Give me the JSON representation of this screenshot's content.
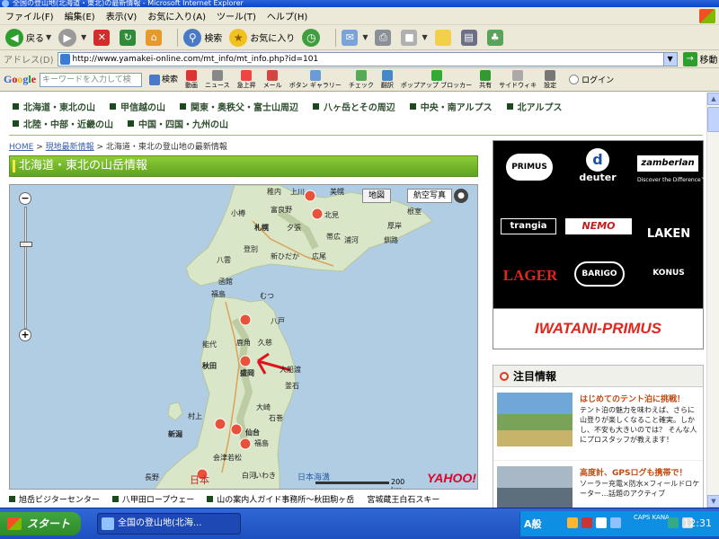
{
  "window": {
    "title": "全国の登山地(北海道・東北)の最新情報 - Microsoft Internet Explorer"
  },
  "menu": [
    "ファイル(F)",
    "編集(E)",
    "表示(V)",
    "お気に入り(A)",
    "ツール(T)",
    "ヘルプ(H)"
  ],
  "toolbar": {
    "back_label": "戻る",
    "search_label": "検索",
    "favorites_label": "お気に入り"
  },
  "address": {
    "label": "アドレス(D)",
    "url": "http://www.yamakei-online.com/mt_info/mt_info.php?id=101",
    "go_label": "移動"
  },
  "google_toolbar": {
    "logo_parts": [
      "G",
      "o",
      "o",
      "g",
      "l",
      "e"
    ],
    "search_placeholder": "キーワードを入力して検",
    "search_button": "検索",
    "items": [
      "動画",
      "ニュース",
      "急上昇",
      "メール",
      "ボタン ギャラリー",
      "チェック",
      "翻訳",
      "ポップアップ ブロッカー",
      "共有",
      "サイドウィキ",
      "設定"
    ],
    "login": "ログイン"
  },
  "region_nav": {
    "row1": [
      "北海道・東北の山",
      "甲信越の山",
      "関東・奥秩父・富士山周辺",
      "八ヶ岳とその周辺",
      "中央・南アルプス",
      "北アルプス"
    ],
    "row2": [
      "北陸・中部・近畿の山",
      "中国・四国・九州の山"
    ]
  },
  "breadcrumb": {
    "home": "HOME",
    "sep": ">",
    "section": "現地最新情報",
    "current": "北海道・東北の登山地の最新情報"
  },
  "page_title": "北海道・東北の山岳情報",
  "map": {
    "type_map": "地図",
    "type_aerial": "航空写真",
    "home_icon": "●",
    "zoom_in": "−",
    "zoom_out": "+",
    "scale_label": "200 km",
    "sea_label": "日本海溝",
    "country_label": "日本",
    "logo": "YAHOO!",
    "places": [
      {
        "name": "稚内",
        "bold": false
      },
      {
        "name": "上川",
        "bold": false
      },
      {
        "name": "美幌",
        "bold": false
      },
      {
        "name": "小樽",
        "bold": false
      },
      {
        "name": "富良野",
        "bold": false
      },
      {
        "name": "北見",
        "bold": false
      },
      {
        "name": "根室",
        "bold": false
      },
      {
        "name": "札幌",
        "bold": true
      },
      {
        "name": "夕張",
        "bold": false
      },
      {
        "name": "帯広",
        "bold": false
      },
      {
        "name": "厚岸",
        "bold": false
      },
      {
        "name": "釧路",
        "bold": false
      },
      {
        "name": "浦河",
        "bold": false
      },
      {
        "name": "登別",
        "bold": false
      },
      {
        "name": "新ひだか",
        "bold": false
      },
      {
        "name": "八雲",
        "bold": false
      },
      {
        "name": "広尾",
        "bold": false
      },
      {
        "name": "函館",
        "bold": false
      },
      {
        "name": "福島",
        "bold": false
      },
      {
        "name": "むつ",
        "bold": false
      },
      {
        "name": "八戸",
        "bold": false
      },
      {
        "name": "能代",
        "bold": false
      },
      {
        "name": "鹿角",
        "bold": false
      },
      {
        "name": "久慈",
        "bold": false
      },
      {
        "name": "秋田",
        "bold": true
      },
      {
        "name": "盛岡",
        "bold": true
      },
      {
        "name": "大船渡",
        "bold": false
      },
      {
        "name": "釜石",
        "bold": false
      },
      {
        "name": "村上",
        "bold": false
      },
      {
        "name": "大崎",
        "bold": false
      },
      {
        "name": "石巻",
        "bold": false
      },
      {
        "name": "新潟",
        "bold": true
      },
      {
        "name": "仙台",
        "bold": true
      },
      {
        "name": "福島",
        "bold": false
      },
      {
        "name": "会津若松",
        "bold": false
      },
      {
        "name": "白河",
        "bold": false
      },
      {
        "name": "いわき",
        "bold": false
      },
      {
        "name": "長野",
        "bold": false
      }
    ]
  },
  "bottom_links": [
    "旭岳ビジターセンター",
    "八甲田ロープウェー",
    "山の案内人ガイド事務所〜秋田駒ヶ岳",
    "宮城蔵王白石スキー"
  ],
  "ad": {
    "brands": [
      "PRIMUS",
      "deuter",
      "zamberlan",
      "trangia",
      "NEMO",
      "LAKEN",
      "LAGER",
      "BARIGO",
      "KONUS"
    ],
    "zamberlan_tagline": "Discover the Difference™",
    "banner_text": "IWATANI-PRIMUS"
  },
  "attention": {
    "heading": "注目情報",
    "articles": [
      {
        "title": "はじめてのテント泊に挑戦！",
        "body": "テント泊の魅力を味わえば、さらに山登りが楽しくなること確実。しかし、不安も大きいのでは？ そんな人にプロスタッフが教えます！"
      },
      {
        "title": "高度計、GPSログも携帯で！",
        "body": "ソーラー充電×防水×フィールドロケーター…話題のアクティブ"
      }
    ]
  },
  "taskbar": {
    "start": "スタート",
    "task": "全国の登山地(北海...",
    "ime": "A般",
    "caps": "CAPS KANA",
    "clock": "12:31"
  },
  "colors": {
    "accent_green": "#6fb52a",
    "title_blue": "#0a46c9",
    "primus_red": "#e0261d"
  }
}
